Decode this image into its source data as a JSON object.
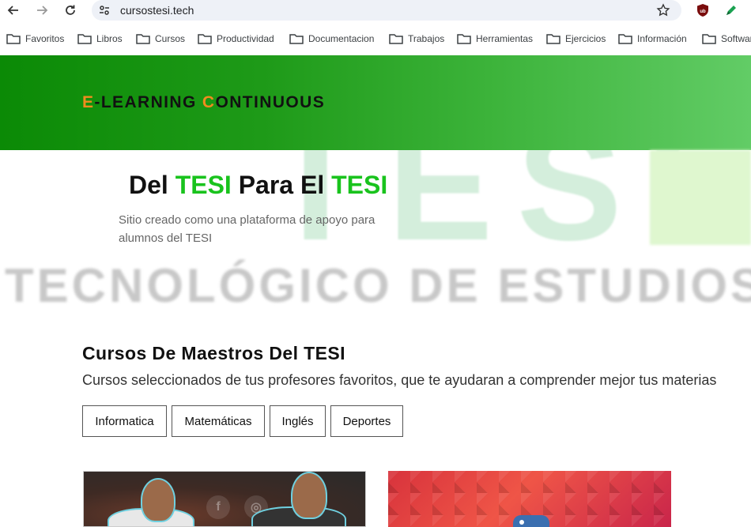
{
  "browser": {
    "url": "cursostesi.tech",
    "bookmarks": [
      "Favoritos",
      "Libros",
      "Cursos",
      "Productividad",
      "Documentacion",
      "Trabajos",
      "Herramientas",
      "Ejercicios",
      "Información",
      "Software"
    ]
  },
  "hero": {
    "brand_e": "E",
    "brand_learning": "-LEARNING ",
    "brand_c": "C",
    "brand_ontinuous": "ONTINUOUS"
  },
  "watermark": {
    "top": "TESI",
    "mid": "TECNOLÓGICO DE ESTUDIOS S"
  },
  "intro": {
    "del": "Del ",
    "tesi1": "TESI",
    "para_el": " Para El ",
    "tesi2": "TESI",
    "description": "Sitio creado como una plataforma de apoyo para alumnos del TESI"
  },
  "courses": {
    "title": "Cursos De Maestros Del TESI",
    "subtitle": "Cursos seleccionados de tus profesores favoritos, que te ayudaran a comprender mejor tus materias",
    "filters": [
      "Informatica",
      "Matemáticas",
      "Inglés",
      "Deportes"
    ],
    "card1_social": [
      "f",
      "◎"
    ]
  },
  "colors": {
    "accent_orange": "#f08c1e",
    "tesi_green": "#19c31d",
    "hero_green_start": "#0b8a06",
    "hero_green_end": "#62cc66"
  },
  "icons": {
    "back": "back-arrow-icon",
    "forward": "forward-arrow-icon",
    "reload": "reload-icon",
    "site_info": "tune-icon",
    "bookmark_star": "star-icon",
    "ublock": "ublock-shield-icon",
    "pen_ext": "pen-icon",
    "folder": "folder-icon"
  }
}
